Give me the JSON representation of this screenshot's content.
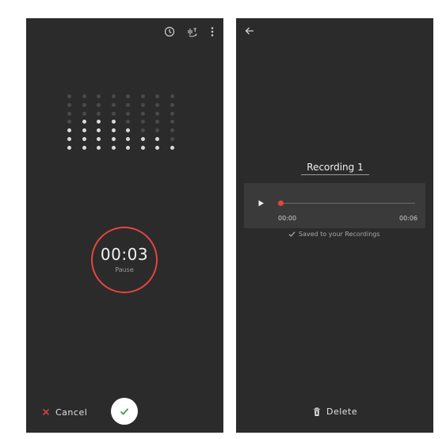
{
  "record_screen": {
    "toolbar": {
      "icons": [
        "history-icon",
        "stt-icon",
        "more-options-icon"
      ]
    },
    "levels": {
      "columns": 8,
      "rows": 7,
      "lit_per_column": [
        3,
        4,
        4,
        4,
        3,
        2,
        2,
        1
      ]
    },
    "timer": {
      "time": "00:03",
      "label": "Pause"
    },
    "cancel_label": "Cancel",
    "colors": {
      "accent": "#e5453e",
      "confirm": "#3c9a3c",
      "background": "#2b2b2b"
    }
  },
  "saved_screen": {
    "title": "Recording 1",
    "player": {
      "start": "00:00",
      "end": "00:06",
      "progress": 0
    },
    "saved_message": "Saved to your Recordings",
    "delete_label": "Delete"
  }
}
